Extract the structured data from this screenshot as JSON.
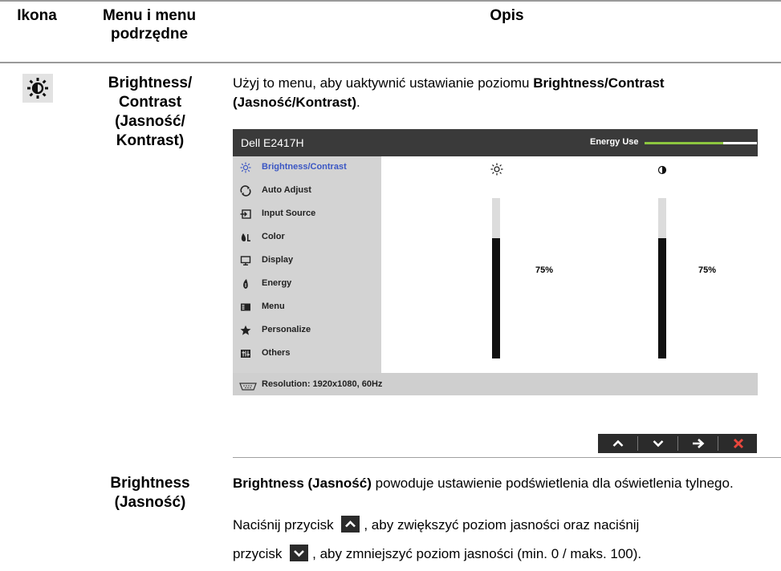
{
  "table": {
    "headers": {
      "icon": "Ikona",
      "menu": "Menu i menu podrzędne",
      "desc": "Opis"
    }
  },
  "row1": {
    "submenu": "Brightness/ Contrast (Jasność/ Kontrast)",
    "intro_pre": "Użyj to menu, aby uaktywnić ustawianie poziomu ",
    "intro_bold": "Brightness/Contrast (Jasność/Kontrast)",
    "intro_post": ".",
    "icon": "brightness-sun-icon"
  },
  "osd": {
    "model": "Dell E2417H",
    "energy_label": "Energy Use",
    "energy_level": 0.7,
    "menu": [
      {
        "label": "Brightness/Contrast",
        "icon": "sun-icon",
        "active": true
      },
      {
        "label": "Auto Adjust",
        "icon": "auto-adjust-icon",
        "active": false
      },
      {
        "label": "Input Source",
        "icon": "input-source-icon",
        "active": false
      },
      {
        "label": "Color",
        "icon": "color-icon",
        "active": false
      },
      {
        "label": "Display",
        "icon": "display-icon",
        "active": false
      },
      {
        "label": "Energy",
        "icon": "energy-icon",
        "active": false
      },
      {
        "label": "Menu",
        "icon": "menu-icon",
        "active": false
      },
      {
        "label": "Personalize",
        "icon": "star-icon",
        "active": false
      },
      {
        "label": "Others",
        "icon": "others-icon",
        "active": false
      }
    ],
    "brightness": {
      "value": "75%",
      "level": 0.75
    },
    "contrast": {
      "value": "75%",
      "level": 0.75
    },
    "resolution": "Resolution: 1920x1080, 60Hz",
    "nav_buttons": [
      "up-arrow-icon",
      "down-arrow-icon",
      "right-arrow-icon",
      "close-icon"
    ],
    "colors": {
      "header": "#3a3a3a",
      "menu": "#d3d3d3",
      "accent": "#3b57c4",
      "energy": "#8dc63f",
      "close": "#e8463c"
    }
  },
  "row2": {
    "submenu": "Brightness (Jasność)",
    "p1_bold": "Brightness (Jasność)",
    "p1_rest": " powoduje ustawienie podświetlenia dla oświetlenia tylnego.",
    "p2_pre": "Naciśnij przycisk ",
    "p2_post": ", aby zwiększyć poziom jasności oraz naciśnij",
    "p3_pre": "przycisk ",
    "p3_post": ", aby zmniejszyć poziom jasności (min. 0 / maks. 100)."
  }
}
